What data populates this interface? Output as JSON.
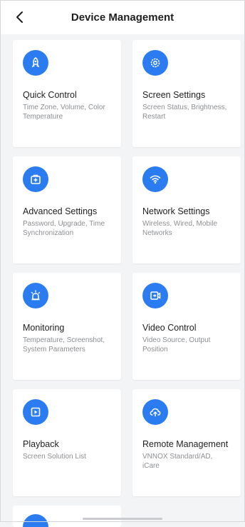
{
  "header": {
    "title": "Device Management",
    "back_icon": "chevron-left-icon"
  },
  "accent_color": "#2b7cf0",
  "cards": [
    {
      "title": "Quick Control",
      "desc": "Time Zone, Volume, Color Temperature",
      "icon": "rocket-icon"
    },
    {
      "title": "Screen Settings",
      "desc": "Screen Status, Brightness, Restart",
      "icon": "gear-icon"
    },
    {
      "title": "Advanced Settings",
      "desc": "Password, Upgrade, Time Synchronization",
      "icon": "toolbox-plus-icon"
    },
    {
      "title": "Network Settings",
      "desc": "Wireless, Wired, Mobile Networks",
      "icon": "wifi-icon"
    },
    {
      "title": "Monitoring",
      "desc": "Temperature, Screenshot, System Parameters",
      "icon": "alarm-light-icon"
    },
    {
      "title": "Video Control",
      "desc": "Video Source, Output Position",
      "icon": "video-source-icon"
    },
    {
      "title": "Playback",
      "desc": "Screen Solution List",
      "icon": "play-box-icon"
    },
    {
      "title": "Remote Management",
      "desc": "VNNOX Standard/AD, iCare",
      "icon": "cloud-upload-icon"
    }
  ]
}
